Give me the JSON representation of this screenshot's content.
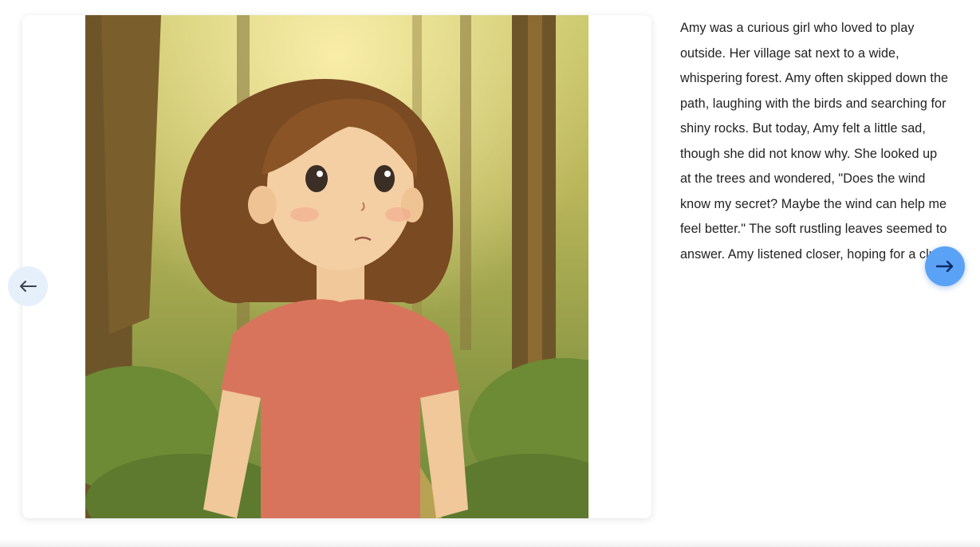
{
  "story": {
    "text": "Amy was a curious girl who loved to play outside. Her village sat next to a wide, whispering forest. Amy often skipped down the path, laughing with the birds and searching for shiny rocks. But today, Amy felt a little sad, though she did not know why. She looked up at the trees and wondered, \"Does the wind know my secret? Maybe the wind can help me feel better.\" The soft rustling leaves seemed to answer. Amy listened closer, hoping for a clue."
  },
  "illustration": {
    "subject": "girl-in-forest-illustration"
  },
  "navigation": {
    "prev_icon": "arrow-left-icon",
    "next_icon": "arrow-right-icon"
  },
  "colors": {
    "next_button": "#5aa2f6",
    "prev_button": "#e6f0fb",
    "text": "#222222"
  }
}
